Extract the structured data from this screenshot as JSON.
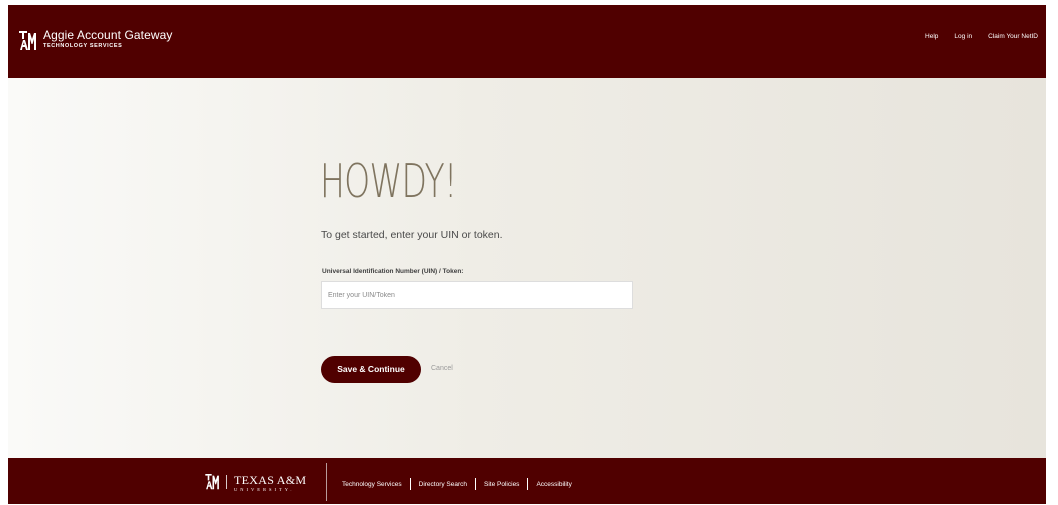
{
  "header": {
    "title": "Aggie Account Gateway",
    "subtitle": "TECHNOLOGY SERVICES",
    "nav": {
      "help": "Help",
      "login": "Log in",
      "claim": "Claim Your NetID"
    }
  },
  "main": {
    "greeting": "HOWDY!",
    "intro": "To get started, enter your UIN or token.",
    "field_label": "Universal Identification Number (UIN) / Token:",
    "field_placeholder": "Enter your UIN/Token",
    "save_label": "Save & Continue",
    "cancel_label": "Cancel"
  },
  "footer": {
    "wordmark": "TEXAS A&M",
    "wordmark_sub": "UNIVERSITY.",
    "links": {
      "technology_services": "Technology Services",
      "directory_search": "Directory Search",
      "site_policies": "Site Policies",
      "accessibility": "Accessibility"
    }
  },
  "colors": {
    "maroon": "#500000",
    "heading": "#7f745f"
  },
  "icons": {
    "header_logo": "atm-logo-icon",
    "footer_logo": "atm-logo-icon"
  }
}
